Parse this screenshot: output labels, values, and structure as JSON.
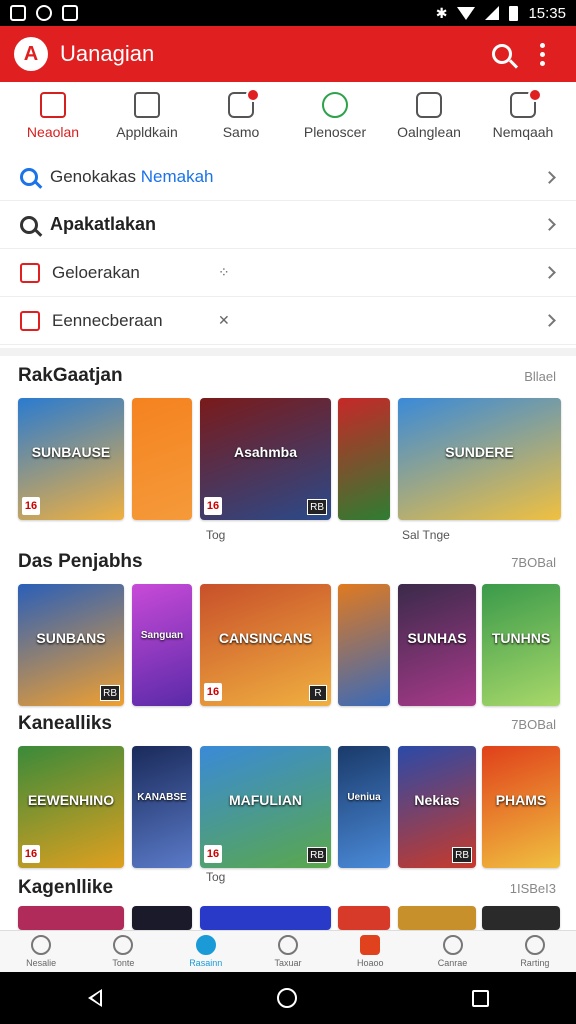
{
  "status_bar": {
    "time": "15:35"
  },
  "app_bar": {
    "title": "Uanagian",
    "logo_glyph": "A"
  },
  "categories": [
    {
      "label": "Neaolan",
      "icon": "home-icon",
      "active": true
    },
    {
      "label": "Appldkain",
      "icon": "apps-icon",
      "active": false
    },
    {
      "label": "Samo",
      "icon": "games-icon",
      "active": false
    },
    {
      "label": "Plenoscer",
      "icon": "refresh-icon",
      "active": false
    },
    {
      "label": "Oalnglean",
      "icon": "calendar-icon",
      "active": false
    },
    {
      "label": "Nemqaah",
      "icon": "notification-icon",
      "active": false
    }
  ],
  "menu": [
    {
      "prefix": "Genokakas ",
      "accent": "Nemakah",
      "icon": "search-icon"
    },
    {
      "text": "Apakatlakan",
      "icon": "search-icon"
    },
    {
      "text": "Geloerakan",
      "mark": "⁘",
      "icon": "app-icon"
    },
    {
      "text": "Eennecberaan",
      "mark": "✕",
      "icon": "app-icon"
    }
  ],
  "sections": [
    {
      "title": "RakGaatjan",
      "more": "Bllael",
      "tiles": [
        {
          "label": "SUNBAUSE",
          "rating": "16",
          "tag": "",
          "colors": [
            "#2a7bd0",
            "#f0b040"
          ]
        },
        {
          "label": "",
          "rating": "",
          "tag": "",
          "colors": [
            "#f5821f",
            "#f59a3a"
          ]
        },
        {
          "label": "Asahmba",
          "rating": "16",
          "tag": "RB",
          "colors": [
            "#7a1a1a",
            "#2a4a8a"
          ]
        },
        {
          "label": "",
          "rating": "",
          "tag": "",
          "colors": [
            "#c62828",
            "#2e7d32"
          ]
        },
        {
          "label": "SUNDERE",
          "rating": "",
          "tag": "",
          "colors": [
            "#3a8ad8",
            "#f0c040"
          ]
        }
      ],
      "captions": [
        "Tog",
        "Sal Tnge"
      ]
    },
    {
      "title": "Das Penjabhs",
      "more": "7BOBal",
      "tiles": [
        {
          "label": "SUNBANS",
          "rating": "",
          "tag": "RB",
          "colors": [
            "#2a5fb8",
            "#f0a030"
          ]
        },
        {
          "label": "Sanguan",
          "rating": "",
          "tag": "",
          "colors": [
            "#c84ad8",
            "#5a2aa8"
          ]
        },
        {
          "label": "CANSINCANS",
          "rating": "16",
          "tag": "R",
          "colors": [
            "#c8502a",
            "#f0b040"
          ]
        },
        {
          "label": "",
          "rating": "",
          "tag": "",
          "colors": [
            "#e07a20",
            "#3a6ab8"
          ]
        },
        {
          "label": "SUNHAS",
          "rating": "",
          "tag": "",
          "colors": [
            "#3a2a4a",
            "#a83a8a"
          ]
        },
        {
          "label": "TUNHNS",
          "rating": "",
          "tag": "",
          "colors": [
            "#3a9a4a",
            "#a8d86a"
          ]
        }
      ],
      "captions": []
    },
    {
      "title": "Kanealliks",
      "more": "7BOBal",
      "tiles": [
        {
          "label": "EEWENHINO",
          "rating": "16",
          "tag": "",
          "colors": [
            "#3a8a3a",
            "#e0a020"
          ]
        },
        {
          "label": "KANABSE",
          "rating": "",
          "tag": "",
          "colors": [
            "#1a2a5a",
            "#5a7ac8"
          ]
        },
        {
          "label": "MAFULIAN",
          "rating": "16",
          "tag": "RB",
          "colors": [
            "#3a8ad8",
            "#5aa84a"
          ]
        },
        {
          "label": "Ueniua",
          "rating": "",
          "tag": "",
          "colors": [
            "#1a3a6a",
            "#4a8ad8"
          ]
        },
        {
          "label": "Nekias",
          "rating": "",
          "tag": "RB",
          "colors": [
            "#2a4aa8",
            "#c83a2a"
          ]
        },
        {
          "label": "PHAMS",
          "rating": "",
          "tag": "",
          "colors": [
            "#e0401a",
            "#f0c040"
          ]
        }
      ],
      "captions": [
        "Tog"
      ]
    },
    {
      "title": "Kagenllike",
      "more": "1ISBeI3",
      "tiles": [],
      "captions": []
    }
  ],
  "bottom_nav": [
    {
      "label": "Nesalie",
      "icon": "home-icon",
      "active": false
    },
    {
      "label": "Tonte",
      "icon": "search-icon",
      "active": false
    },
    {
      "label": "Rasainn",
      "icon": "edit-icon",
      "active": true
    },
    {
      "label": "Taxuar",
      "icon": "explore-icon",
      "active": false
    },
    {
      "label": "Hoaoo",
      "icon": "store-icon",
      "active": false
    },
    {
      "label": "Canrae",
      "icon": "account-icon",
      "active": false
    },
    {
      "label": "Rarting",
      "icon": "settings-icon",
      "active": false
    }
  ]
}
